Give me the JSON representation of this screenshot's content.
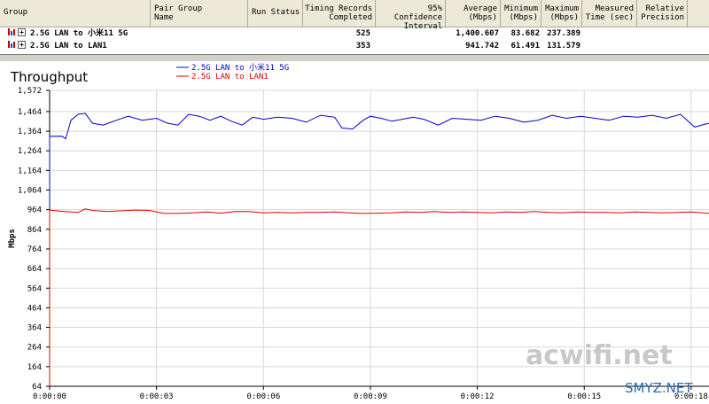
{
  "table": {
    "columns": [
      {
        "key": "group",
        "label": "Group"
      },
      {
        "key": "pair_group",
        "label": "Pair Group\nName"
      },
      {
        "key": "run_status",
        "label": "Run Status"
      },
      {
        "key": "records",
        "label": "Timing Records\nCompleted"
      },
      {
        "key": "confidence",
        "label": "95% Confidence\nInterval"
      },
      {
        "key": "average",
        "label": "Average\n(Mbps)"
      },
      {
        "key": "minimum",
        "label": "Minimum\n(Mbps)"
      },
      {
        "key": "maximum",
        "label": "Maximum\n(Mbps)"
      },
      {
        "key": "measured",
        "label": "Measured\nTime (sec)"
      },
      {
        "key": "precision",
        "label": "Relative\nPrecision"
      }
    ],
    "rows": [
      {
        "name": "2.5G LAN to 小米11 5G",
        "records": "525",
        "average": "1,400.607",
        "minimum": "83.682",
        "maximum": "237.389"
      },
      {
        "name": "2.5G LAN to LAN1",
        "records": "353",
        "average": "941.742",
        "minimum": "61.491",
        "maximum": "131.579"
      }
    ]
  },
  "chart_data": {
    "type": "line",
    "title": "Throughput",
    "ylabel": "Mbps",
    "xlabel": "",
    "ylim": [
      64,
      1572
    ],
    "yticks": [
      64,
      164,
      264,
      364,
      464,
      564,
      664,
      764,
      864,
      964,
      1064,
      1164,
      1264,
      1364,
      1464,
      1572
    ],
    "ytick_labels": [
      "64",
      "164",
      "264",
      "364",
      "464",
      "564",
      "664",
      "764",
      "864",
      "964",
      "1,064",
      "1,164",
      "1,264",
      "1,364",
      "1,464",
      "1,572"
    ],
    "xlim": [
      0,
      18.5
    ],
    "xticks": [
      0,
      3,
      6,
      9,
      12,
      15,
      18
    ],
    "xtick_labels": [
      "0:00:00",
      "0:00:03",
      "0:00:06",
      "0:00:09",
      "0:00:12",
      "0:00:15",
      "0:00:18"
    ],
    "grid": true,
    "legend_position": "top-center",
    "series": [
      {
        "name": "2.5G LAN to 小米11 5G",
        "color": "#0000cc",
        "x": [
          0,
          0.35,
          0.45,
          0.6,
          0.8,
          1.0,
          1.2,
          1.5,
          1.8,
          2.2,
          2.6,
          3.0,
          3.3,
          3.6,
          3.9,
          4.2,
          4.5,
          4.8,
          5.1,
          5.4,
          5.7,
          6.0,
          6.4,
          6.8,
          7.2,
          7.6,
          8.0,
          8.2,
          8.5,
          8.8,
          9.0,
          9.3,
          9.6,
          9.9,
          10.2,
          10.5,
          10.9,
          11.3,
          11.7,
          12.1,
          12.5,
          12.9,
          13.3,
          13.7,
          14.1,
          14.5,
          14.9,
          15.3,
          15.7,
          16.1,
          16.5,
          16.9,
          17.3,
          17.7,
          18.1,
          18.5
        ],
        "y": [
          1338,
          1338,
          1325,
          1420,
          1450,
          1455,
          1405,
          1395,
          1415,
          1440,
          1420,
          1430,
          1405,
          1395,
          1450,
          1440,
          1420,
          1440,
          1415,
          1395,
          1435,
          1425,
          1435,
          1430,
          1410,
          1445,
          1435,
          1380,
          1375,
          1420,
          1440,
          1430,
          1415,
          1425,
          1435,
          1425,
          1395,
          1430,
          1425,
          1420,
          1440,
          1430,
          1410,
          1420,
          1445,
          1430,
          1440,
          1430,
          1420,
          1440,
          1435,
          1445,
          1430,
          1450,
          1385,
          1405
        ]
      },
      {
        "name": "2.5G LAN to LAN1",
        "color": "#e00000",
        "x": [
          0,
          0.4,
          0.8,
          1.0,
          1.2,
          1.6,
          2.0,
          2.4,
          2.8,
          3.2,
          3.6,
          4.0,
          4.4,
          4.8,
          5.2,
          5.6,
          6.0,
          6.4,
          6.8,
          7.2,
          7.6,
          8.0,
          8.4,
          8.8,
          9.2,
          9.6,
          10.0,
          10.4,
          10.8,
          11.2,
          11.6,
          12.0,
          12.4,
          12.8,
          13.2,
          13.6,
          14.0,
          14.4,
          14.8,
          15.2,
          15.6,
          16.0,
          16.4,
          16.8,
          17.2,
          17.6,
          18.0,
          18.5
        ],
        "y": [
          962,
          955,
          950,
          968,
          960,
          955,
          958,
          962,
          960,
          945,
          945,
          948,
          952,
          946,
          955,
          955,
          948,
          950,
          948,
          950,
          950,
          952,
          948,
          945,
          946,
          948,
          952,
          950,
          955,
          950,
          952,
          950,
          948,
          952,
          950,
          955,
          950,
          948,
          952,
          950,
          950,
          948,
          952,
          950,
          948,
          950,
          952,
          945
        ]
      }
    ]
  },
  "watermarks": [
    "acwifi.net",
    "SMYZ.NET"
  ]
}
